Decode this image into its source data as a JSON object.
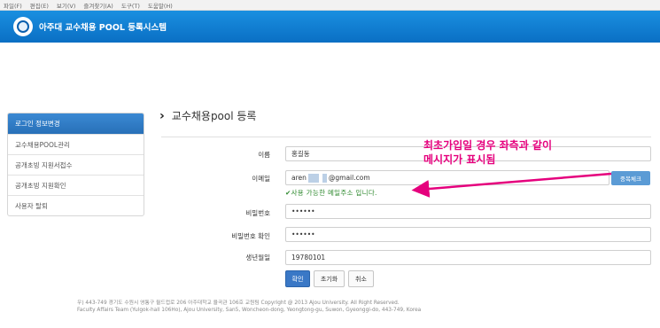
{
  "menu": [
    "파일(F)",
    "편집(E)",
    "보기(V)",
    "즐겨찾기(A)",
    "도구(T)",
    "도움말(H)"
  ],
  "header": {
    "title": "아주대 교수채용 POOL 등록시스템"
  },
  "sidebar": {
    "items": [
      {
        "label": "로그인 정보변경"
      },
      {
        "label": "교수채용POOL관리"
      },
      {
        "label": "공개초빙 지원서접수"
      },
      {
        "label": "공개초빙 지원확인"
      },
      {
        "label": "사용자 탈퇴"
      }
    ]
  },
  "page": {
    "title": "교수채용pool 등록"
  },
  "form": {
    "name_label": "이름",
    "name_value": "홍길동",
    "email_label": "이메일",
    "email_prefix": "aren",
    "email_suffix": "@gmail.com",
    "dup_check_label": "중복체크",
    "email_ok_message": "✔사용 가능한 메일주소 입니다.",
    "password_label": "비밀번호",
    "password_value": "••••••",
    "password_confirm_label": "비밀번호 확인",
    "password_confirm_value": "••••••",
    "birth_label": "생년월일",
    "birth_value": "19780101"
  },
  "buttons": {
    "confirm": "확인",
    "reset": "초기화",
    "cancel": "취소"
  },
  "footer": {
    "line1": "우) 443-749 경기도 수원시 영통구 월드컵로 206 아주대학교 율곡관 106호 교원팀 Copyright @ 2013 Ajou University. All Right Reserved.",
    "line2": "Faculty Affairs Team (Yulgok-hall 106Ho), Ajou University, San5, Woncheon-dong, Yeongtong-gu, Suwon, Gyeonggi-do, 443-749, Korea"
  },
  "annotation": {
    "line1": "최초가입일 경우 좌측과 같이",
    "line2": "메시지가 표시됨"
  },
  "colors": {
    "header": "#0a6fc4",
    "annotation": "#e5007d",
    "ok_message": "#2f8a2f",
    "primary_button": "#3a78c6"
  }
}
